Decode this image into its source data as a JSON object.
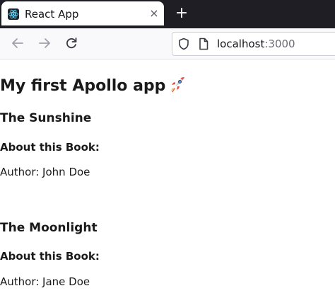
{
  "browser": {
    "tab": {
      "title": "React App",
      "close_glyph": "×"
    },
    "new_tab_glyph": "+",
    "address": {
      "host": "localhost",
      "port": ":3000"
    }
  },
  "page": {
    "title": "My first Apollo app",
    "title_icon": "rocket-emoji",
    "books": [
      {
        "title": "The Sunshine",
        "about_label": "About this Book:",
        "author_line": "Author: John Doe"
      },
      {
        "title": "The Moonlight",
        "about_label": "About this Book:",
        "author_line": "Author: Jane Doe"
      }
    ]
  }
}
